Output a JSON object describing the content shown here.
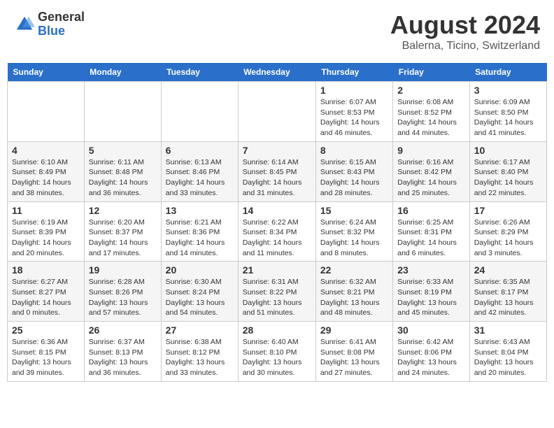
{
  "logo": {
    "general": "General",
    "blue": "Blue"
  },
  "title": "August 2024",
  "location": "Balerna, Ticino, Switzerland",
  "days_of_week": [
    "Sunday",
    "Monday",
    "Tuesday",
    "Wednesday",
    "Thursday",
    "Friday",
    "Saturday"
  ],
  "weeks": [
    [
      {
        "day": "",
        "info": ""
      },
      {
        "day": "",
        "info": ""
      },
      {
        "day": "",
        "info": ""
      },
      {
        "day": "",
        "info": ""
      },
      {
        "day": "1",
        "info": "Sunrise: 6:07 AM\nSunset: 8:53 PM\nDaylight: 14 hours\nand 46 minutes."
      },
      {
        "day": "2",
        "info": "Sunrise: 6:08 AM\nSunset: 8:52 PM\nDaylight: 14 hours\nand 44 minutes."
      },
      {
        "day": "3",
        "info": "Sunrise: 6:09 AM\nSunset: 8:50 PM\nDaylight: 14 hours\nand 41 minutes."
      }
    ],
    [
      {
        "day": "4",
        "info": "Sunrise: 6:10 AM\nSunset: 8:49 PM\nDaylight: 14 hours\nand 38 minutes."
      },
      {
        "day": "5",
        "info": "Sunrise: 6:11 AM\nSunset: 8:48 PM\nDaylight: 14 hours\nand 36 minutes."
      },
      {
        "day": "6",
        "info": "Sunrise: 6:13 AM\nSunset: 8:46 PM\nDaylight: 14 hours\nand 33 minutes."
      },
      {
        "day": "7",
        "info": "Sunrise: 6:14 AM\nSunset: 8:45 PM\nDaylight: 14 hours\nand 31 minutes."
      },
      {
        "day": "8",
        "info": "Sunrise: 6:15 AM\nSunset: 8:43 PM\nDaylight: 14 hours\nand 28 minutes."
      },
      {
        "day": "9",
        "info": "Sunrise: 6:16 AM\nSunset: 8:42 PM\nDaylight: 14 hours\nand 25 minutes."
      },
      {
        "day": "10",
        "info": "Sunrise: 6:17 AM\nSunset: 8:40 PM\nDaylight: 14 hours\nand 22 minutes."
      }
    ],
    [
      {
        "day": "11",
        "info": "Sunrise: 6:19 AM\nSunset: 8:39 PM\nDaylight: 14 hours\nand 20 minutes."
      },
      {
        "day": "12",
        "info": "Sunrise: 6:20 AM\nSunset: 8:37 PM\nDaylight: 14 hours\nand 17 minutes."
      },
      {
        "day": "13",
        "info": "Sunrise: 6:21 AM\nSunset: 8:36 PM\nDaylight: 14 hours\nand 14 minutes."
      },
      {
        "day": "14",
        "info": "Sunrise: 6:22 AM\nSunset: 8:34 PM\nDaylight: 14 hours\nand 11 minutes."
      },
      {
        "day": "15",
        "info": "Sunrise: 6:24 AM\nSunset: 8:32 PM\nDaylight: 14 hours\nand 8 minutes."
      },
      {
        "day": "16",
        "info": "Sunrise: 6:25 AM\nSunset: 8:31 PM\nDaylight: 14 hours\nand 6 minutes."
      },
      {
        "day": "17",
        "info": "Sunrise: 6:26 AM\nSunset: 8:29 PM\nDaylight: 14 hours\nand 3 minutes."
      }
    ],
    [
      {
        "day": "18",
        "info": "Sunrise: 6:27 AM\nSunset: 8:27 PM\nDaylight: 14 hours\nand 0 minutes."
      },
      {
        "day": "19",
        "info": "Sunrise: 6:28 AM\nSunset: 8:26 PM\nDaylight: 13 hours\nand 57 minutes."
      },
      {
        "day": "20",
        "info": "Sunrise: 6:30 AM\nSunset: 8:24 PM\nDaylight: 13 hours\nand 54 minutes."
      },
      {
        "day": "21",
        "info": "Sunrise: 6:31 AM\nSunset: 8:22 PM\nDaylight: 13 hours\nand 51 minutes."
      },
      {
        "day": "22",
        "info": "Sunrise: 6:32 AM\nSunset: 8:21 PM\nDaylight: 13 hours\nand 48 minutes."
      },
      {
        "day": "23",
        "info": "Sunrise: 6:33 AM\nSunset: 8:19 PM\nDaylight: 13 hours\nand 45 minutes."
      },
      {
        "day": "24",
        "info": "Sunrise: 6:35 AM\nSunset: 8:17 PM\nDaylight: 13 hours\nand 42 minutes."
      }
    ],
    [
      {
        "day": "25",
        "info": "Sunrise: 6:36 AM\nSunset: 8:15 PM\nDaylight: 13 hours\nand 39 minutes."
      },
      {
        "day": "26",
        "info": "Sunrise: 6:37 AM\nSunset: 8:13 PM\nDaylight: 13 hours\nand 36 minutes."
      },
      {
        "day": "27",
        "info": "Sunrise: 6:38 AM\nSunset: 8:12 PM\nDaylight: 13 hours\nand 33 minutes."
      },
      {
        "day": "28",
        "info": "Sunrise: 6:40 AM\nSunset: 8:10 PM\nDaylight: 13 hours\nand 30 minutes."
      },
      {
        "day": "29",
        "info": "Sunrise: 6:41 AM\nSunset: 8:08 PM\nDaylight: 13 hours\nand 27 minutes."
      },
      {
        "day": "30",
        "info": "Sunrise: 6:42 AM\nSunset: 8:06 PM\nDaylight: 13 hours\nand 24 minutes."
      },
      {
        "day": "31",
        "info": "Sunrise: 6:43 AM\nSunset: 8:04 PM\nDaylight: 13 hours\nand 20 minutes."
      }
    ]
  ]
}
